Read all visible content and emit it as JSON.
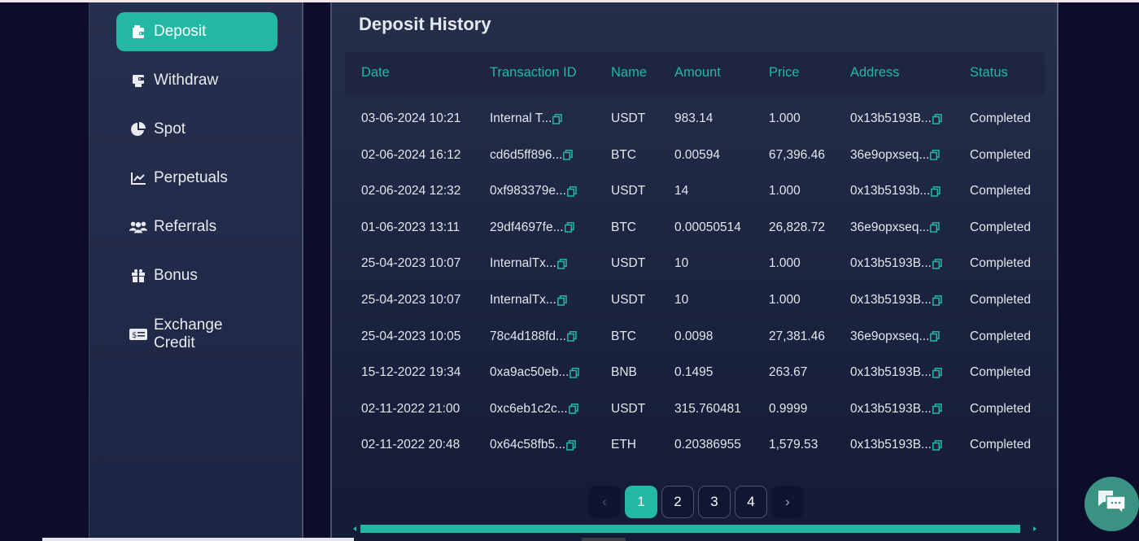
{
  "sidebar": {
    "items": [
      {
        "label": "Deposit",
        "icon": "wallet-icon",
        "active": true
      },
      {
        "label": "Withdraw",
        "icon": "wallet-out-icon",
        "active": false
      },
      {
        "label": "Spot",
        "icon": "pie-chart-icon",
        "active": false
      },
      {
        "label": "Perpetuals",
        "icon": "line-chart-icon",
        "active": false
      },
      {
        "label": "Referrals",
        "icon": "users-icon",
        "active": false
      },
      {
        "label": "Bonus",
        "icon": "gift-icon",
        "active": false
      },
      {
        "label": "Exchange Credit",
        "icon": "money-check-icon",
        "active": false
      }
    ]
  },
  "main": {
    "title": "Deposit History",
    "columns": [
      "Date",
      "Transaction ID",
      "Name",
      "Amount",
      "Price",
      "Address",
      "Status"
    ],
    "rows": [
      {
        "date": "03-06-2024 10:21",
        "tx": "Internal T...",
        "name": "USDT",
        "amount": "983.14",
        "price": "1.000",
        "address": "0x13b5193B...",
        "status": "Completed"
      },
      {
        "date": "02-06-2024 16:12",
        "tx": "cd6d5ff896...",
        "name": "BTC",
        "amount": "0.00594",
        "price": "67,396.46",
        "address": "36e9opxseq...",
        "status": "Completed"
      },
      {
        "date": "02-06-2024 12:32",
        "tx": "0xf983379e...",
        "name": "USDT",
        "amount": "14",
        "price": "1.000",
        "address": "0x13b5193b...",
        "status": "Completed"
      },
      {
        "date": "01-06-2023 13:11",
        "tx": "29df4697fe...",
        "name": "BTC",
        "amount": "0.00050514",
        "price": "26,828.72",
        "address": "36e9opxseq...",
        "status": "Completed"
      },
      {
        "date": "25-04-2023 10:07",
        "tx": "InternalTx...",
        "name": "USDT",
        "amount": "10",
        "price": "1.000",
        "address": "0x13b5193B...",
        "status": "Completed"
      },
      {
        "date": "25-04-2023 10:07",
        "tx": "InternalTx...",
        "name": "USDT",
        "amount": "10",
        "price": "1.000",
        "address": "0x13b5193B...",
        "status": "Completed"
      },
      {
        "date": "25-04-2023 10:05",
        "tx": "78c4d188fd...",
        "name": "BTC",
        "amount": "0.0098",
        "price": "27,381.46",
        "address": "36e9opxseq...",
        "status": "Completed"
      },
      {
        "date": "15-12-2022 19:34",
        "tx": "0xa9ac50eb...",
        "name": "BNB",
        "amount": "0.1495",
        "price": "263.67",
        "address": "0x13b5193B...",
        "status": "Completed"
      },
      {
        "date": "02-11-2022 21:00",
        "tx": "0xc6eb1c2c...",
        "name": "USDT",
        "amount": "315.760481",
        "price": "0.9999",
        "address": "0x13b5193B...",
        "status": "Completed"
      },
      {
        "date": "02-11-2022 20:48",
        "tx": "0x64c58fb5...",
        "name": "ETH",
        "amount": "0.20386955",
        "price": "1,579.53",
        "address": "0x13b5193B...",
        "status": "Completed"
      }
    ]
  },
  "pagination": {
    "prev": "‹",
    "next": "›",
    "pages": [
      "1",
      "2",
      "3",
      "4"
    ],
    "current": "1"
  },
  "colors": {
    "accent": "#22b8a4",
    "background": "#0b0d2b",
    "panel": "#1d2542",
    "chat": "#3a9382"
  }
}
